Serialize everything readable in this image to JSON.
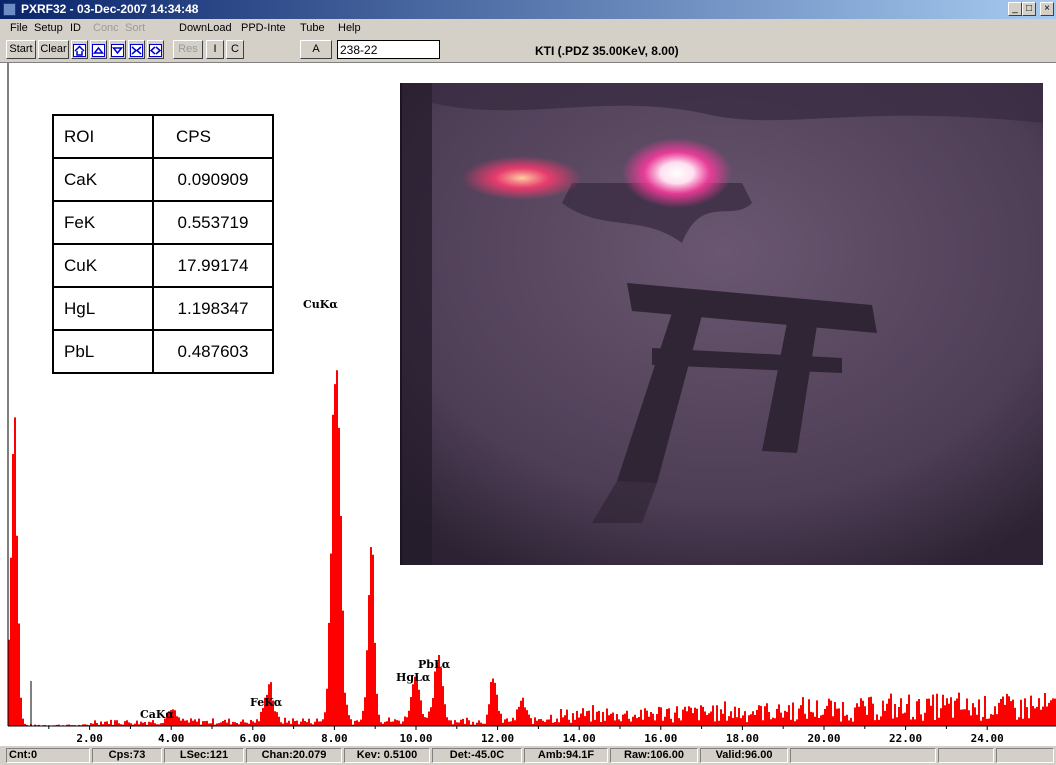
{
  "window": {
    "title": "PXRF32 - 03-Dec-2007 14:34:48",
    "minimize": "_",
    "maximize": "□",
    "close": "×"
  },
  "menu": [
    {
      "label": "File",
      "enabled": true
    },
    {
      "label": "Setup",
      "enabled": true
    },
    {
      "label": "ID",
      "enabled": true
    },
    {
      "label": "Conc",
      "enabled": false
    },
    {
      "label": "Sort",
      "enabled": false
    },
    {
      "label": "DownLoad",
      "enabled": true
    },
    {
      "label": "PPD-Inte",
      "enabled": true
    },
    {
      "label": "Tube",
      "enabled": true
    },
    {
      "label": "Help",
      "enabled": true
    }
  ],
  "toolbar": {
    "start": "Start",
    "clear": "Clear",
    "icons": [
      "home-icon",
      "arrow-up-icon",
      "arrow-down-icon",
      "collapse-icon",
      "expand-icon"
    ],
    "res": "Res",
    "i": "I",
    "c": "C",
    "a": "A",
    "id_value": "238-22",
    "status": "KTI  (.PDZ 35.00KeV, 8.00)"
  },
  "roi_table": {
    "headers": [
      "ROI",
      "CPS"
    ],
    "rows": [
      [
        "CaK",
        "0.090909"
      ],
      [
        "FeK",
        "0.553719"
      ],
      [
        "CuK",
        "17.99174"
      ],
      [
        "HgL",
        "1.198347"
      ],
      [
        "PbL",
        "0.487603"
      ]
    ]
  },
  "spectrum": {
    "color": "#ff0000",
    "x_ticks": [
      "2.00",
      "4.00",
      "6.00",
      "8.00",
      "10.00",
      "12.00",
      "14.00",
      "16.00",
      "18.00",
      "20.00",
      "22.00",
      "24.00"
    ],
    "peaks": [
      {
        "label": "CaKα",
        "kev": 4.0,
        "height": 0.03
      },
      {
        "label": "FeKα",
        "kev": 6.4,
        "height": 0.09
      },
      {
        "label": "CuKα",
        "kev": 8.04,
        "height": 1.0
      },
      {
        "label": "HgLα",
        "kev": 9.99,
        "height": 0.12
      },
      {
        "label": "PbLα",
        "kev": 10.55,
        "height": 0.15
      }
    ]
  },
  "statusbar": {
    "cnt": "Cnt:0",
    "cps": "Cps:73",
    "lsec": "LSec:121",
    "chan": "Chan:20.079",
    "kev": "Kev: 0.5100",
    "det": "Det:-45.0C",
    "amb": "Amb:94.1F",
    "raw": "Raw:106.00",
    "valid": "Valid:96.00"
  }
}
